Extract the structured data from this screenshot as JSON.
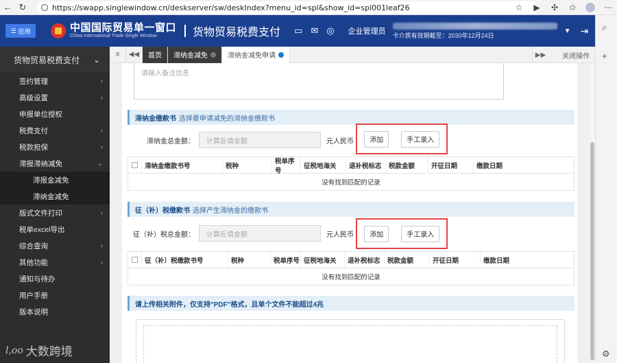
{
  "browser": {
    "url": "https://swapp.singlewindow.cn/deskserver/sw/deskIndex?menu_id=spl&show_id=spl001leaf26"
  },
  "header": {
    "app_button": "应用",
    "logo_cn": "中国国际贸易单一窗口",
    "logo_en": "China International Trade Single Window",
    "module_title": "货物贸易税费支付",
    "role": "企业管理员",
    "expiry": "卡介质有效期截至：2030年12月24日"
  },
  "sidebar": {
    "title": "货物贸易税费支付",
    "items": [
      {
        "label": "签约管理",
        "chevron": true
      },
      {
        "label": "高级设置",
        "chevron": true
      },
      {
        "label": "申报单位授权",
        "chevron": false
      },
      {
        "label": "税费支付",
        "chevron": true
      },
      {
        "label": "税款担保",
        "chevron": true
      },
      {
        "label": "滞报滞纳减免",
        "chevron": true,
        "expanded": true
      }
    ],
    "sub_items": [
      "滞报金减免",
      "滞纳金减免"
    ],
    "items_after": [
      {
        "label": "版式文件打印",
        "chevron": true
      },
      {
        "label": "税单excel导出",
        "chevron": false
      },
      {
        "label": "综合查询",
        "chevron": true
      },
      {
        "label": "其他功能",
        "chevron": true
      },
      {
        "label": "通知与待办",
        "chevron": false
      },
      {
        "label": "用户手册",
        "chevron": false
      },
      {
        "label": "版本说明",
        "chevron": false
      }
    ],
    "watermark": "大数跨境",
    "watermark_logo": "l,oo"
  },
  "tabs": {
    "home": "首页",
    "tab1": "滞纳金减免",
    "tab2": "滞纳金减免申请",
    "close_ops": "关闭操作"
  },
  "form": {
    "remark_placeholder": "请输入备注信息",
    "section1": {
      "title": "滞纳金缴款书",
      "hint": "选择要申请减免的滞纳金缴款书",
      "total_label": "滞纳金总金额：",
      "total_placeholder": "计算反填金额",
      "unit": "元人民币",
      "add": "添加",
      "manual": "手工录入",
      "columns": [
        "滞纳金缴款书号",
        "税种",
        "税单序号",
        "征税地海关",
        "退补税标志",
        "税款金额",
        "开征日期",
        "缴款日期"
      ],
      "empty": "没有找到匹配的记录"
    },
    "section2": {
      "title": "征（补）税缴款书",
      "hint": "选择产生滞纳金的缴款书",
      "total_label": "征（补）税总金额：",
      "total_placeholder": "计算反填金额",
      "unit": "元人民币",
      "add": "添加",
      "manual": "手工录入",
      "columns": [
        "征（补）税缴款书号",
        "税种",
        "税单序号",
        "征税地海关",
        "退补税标志",
        "税款金额",
        "开征日期",
        "缴款日期"
      ],
      "empty": "没有找到匹配的记录"
    },
    "upload_note": "请上传相关附件，仅支持\"PDF\"格式，且单个文件不能超过4兆"
  },
  "colors": {
    "header_bg": "#1b3f8f",
    "sidebar_bg": "#2d2d2d",
    "highlight": "#e34343",
    "section_bg": "#e3eef7"
  }
}
